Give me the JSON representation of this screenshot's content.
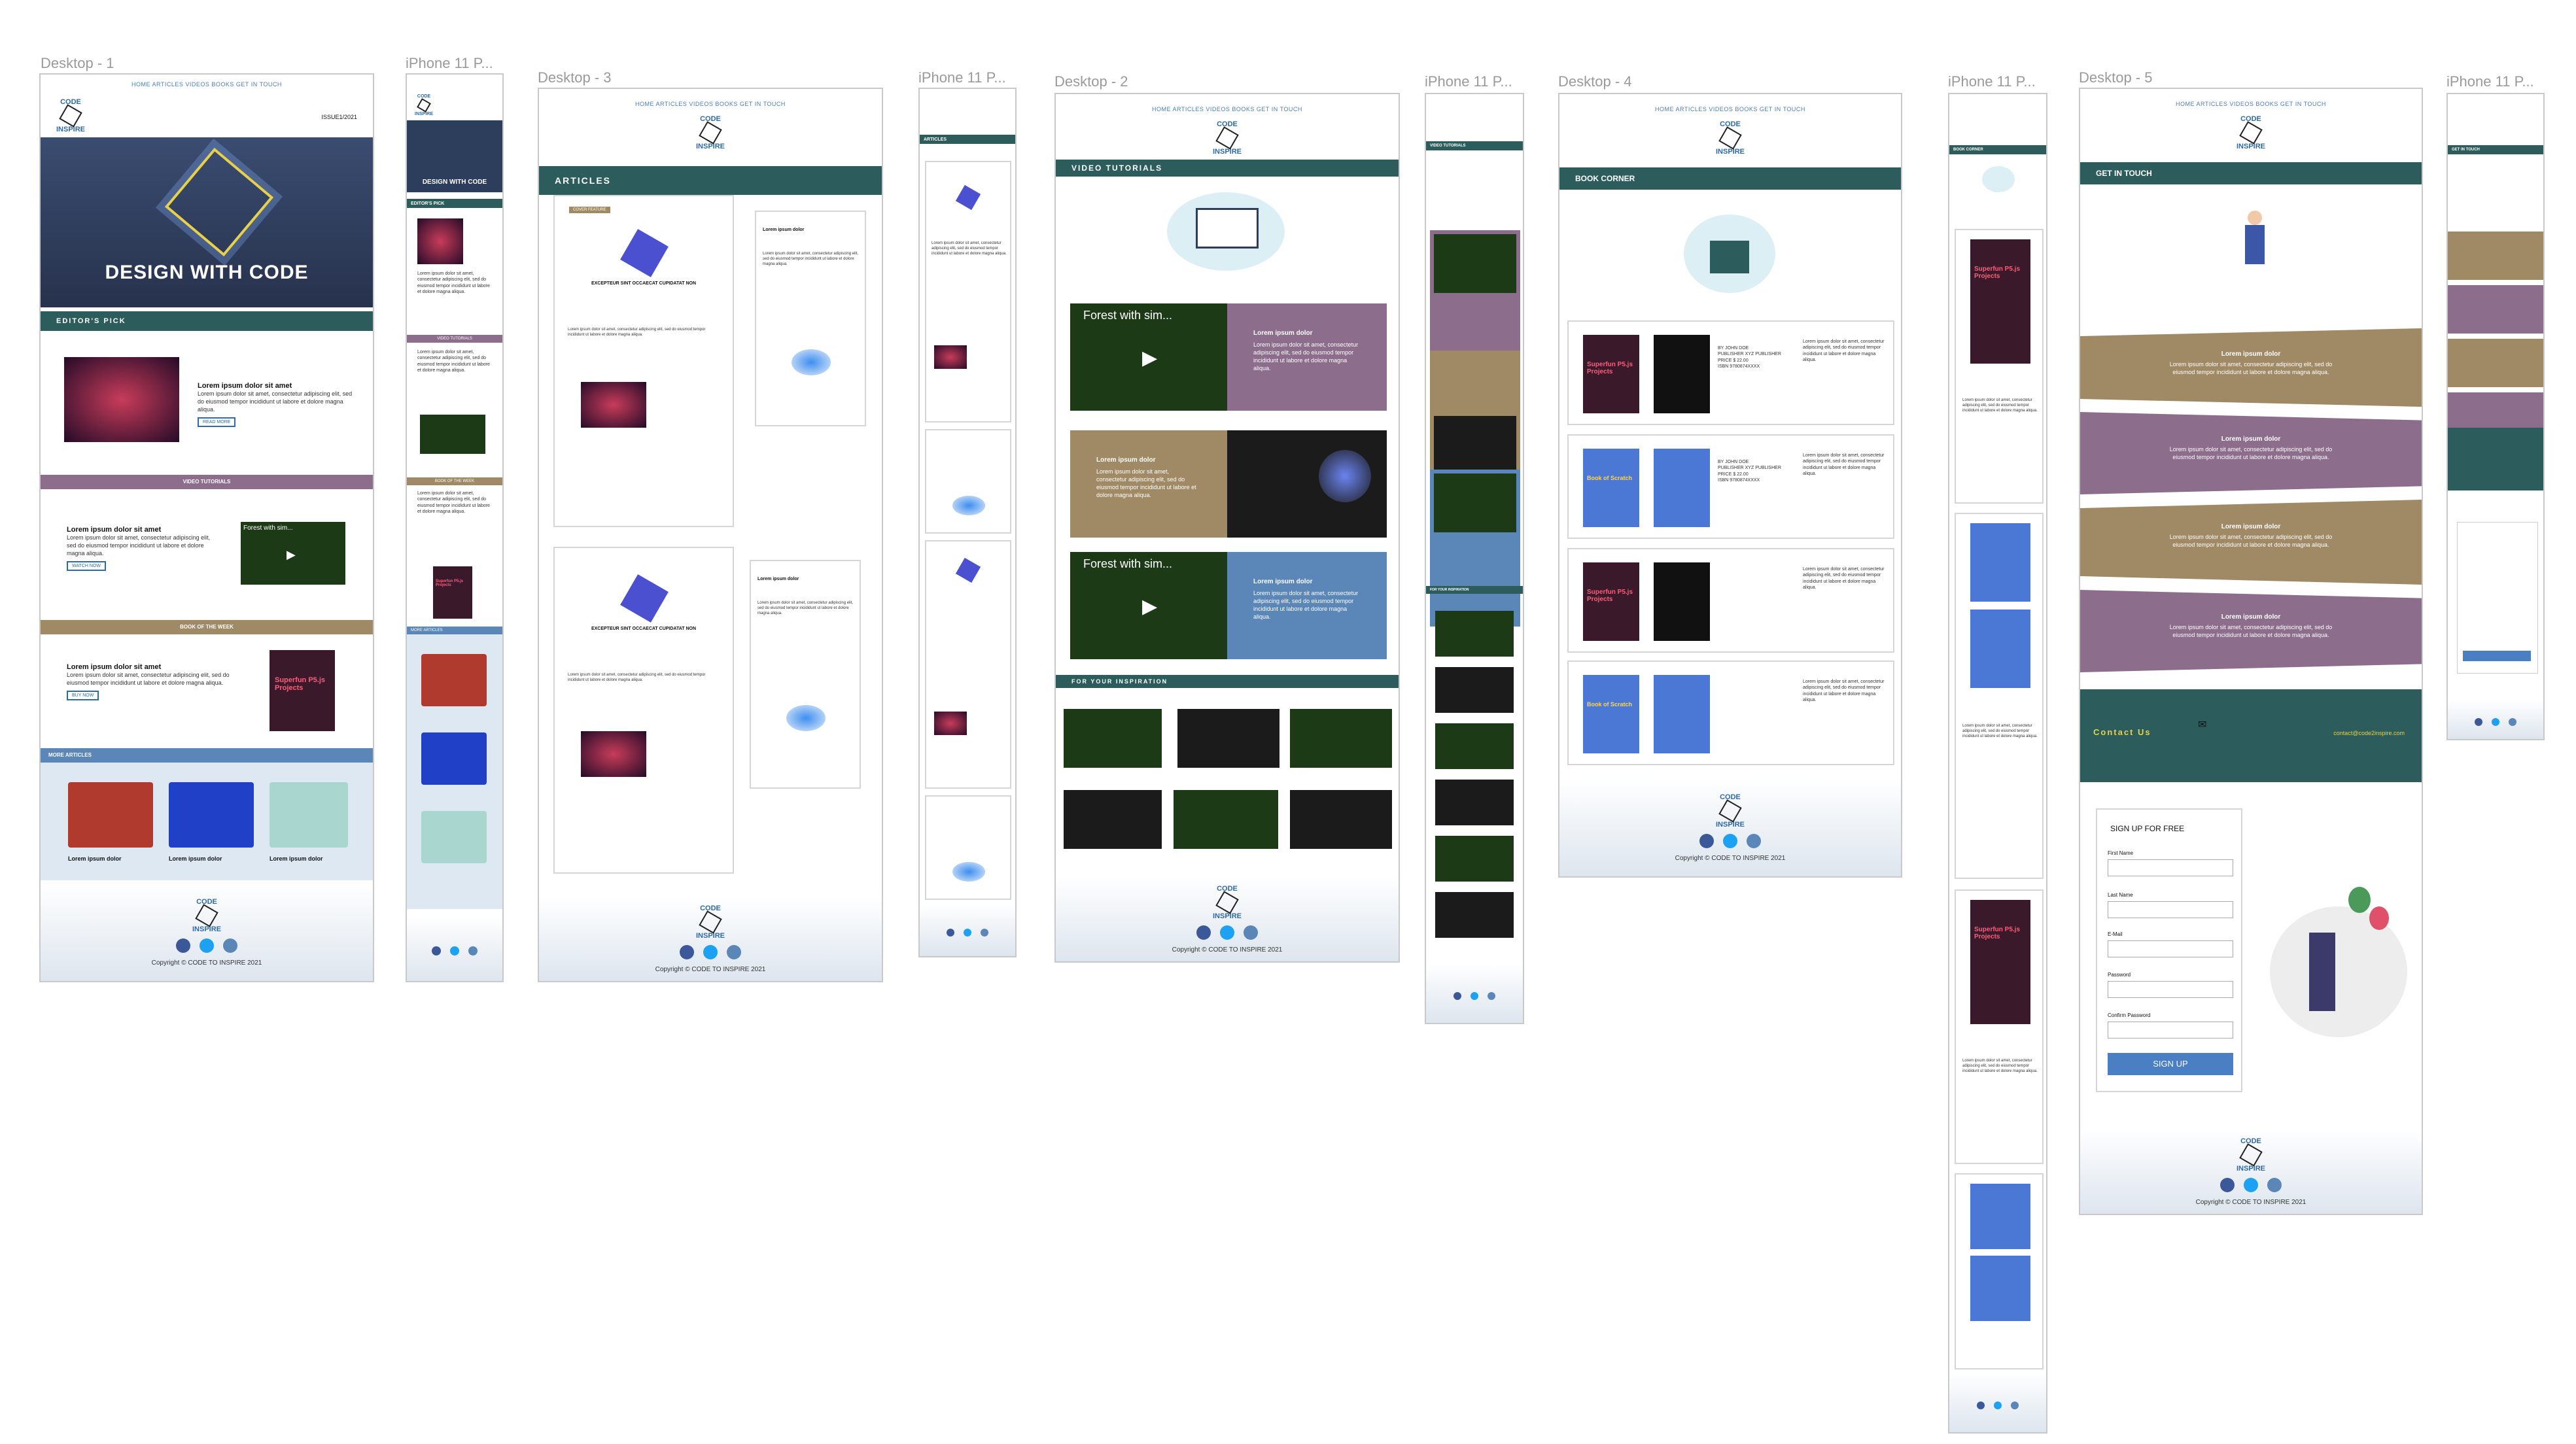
{
  "frames": {
    "desktop1": "Desktop - 1",
    "iphone1": "iPhone 11 P...",
    "desktop3": "Desktop - 3",
    "iphone3": "iPhone 11 P...",
    "desktop2": "Desktop - 2",
    "iphone2": "iPhone 11 P...",
    "desktop4": "Desktop - 4",
    "iphone4": "iPhone 11 P...",
    "desktop5": "Desktop - 5",
    "iphone5": "iPhone 11 P..."
  },
  "nav": "HOME  ARTICLES  VIDEOS  BOOKS  GET IN TOUCH",
  "logo": {
    "top": "CODE",
    "bottom": "INSPIRE"
  },
  "issue": "ISSUE1/2021",
  "hero_title": "DESIGN WITH CODE",
  "sections": {
    "editors_pick": "EDITOR'S PICK",
    "video_tutorials": "VIDEO TUTORIALS",
    "book_of_week": "BOOK OF THE WEEK",
    "more_articles": "MORE ARTICLES",
    "articles": "ARTICLES",
    "for_inspiration": "FOR YOUR INSPIRATION",
    "book_corner": "BOOK CORNER",
    "get_in_touch": "GET IN TOUCH"
  },
  "lorem_title": "Lorem ipsum dolor sit amet",
  "lorem_short": "Lorem ipsum dolor",
  "lorem_body": "Lorem ipsum dolor sit amet, consectetur adipiscing elit, sed do eiusmod tempor incididunt ut labore et dolore magna aliqua.",
  "read_more": "READ MORE",
  "watch_now": "WATCH NOW",
  "buy_now": "BUY NOW",
  "video_title": "Forest with sim...",
  "article_heading": "EXCEPTEUR SINT OCCAECAT CUPIDATAT NON",
  "cover_feature": "COVER FEATURE",
  "book_titles": {
    "a": "Superfun P5.js Projects",
    "b": "Book of Scratch"
  },
  "book_meta": {
    "by": "BY",
    "author": "JOHN DOE",
    "publisher_label": "PUBLISHER",
    "publisher": "XYZ PUBLISHER",
    "price_label": "PRICE",
    "price": "$ 22.00",
    "isbn_label": "ISBN",
    "isbn": "9780874XXXX"
  },
  "contact_us": "Contact Us",
  "email": "contact@code2inspire.com",
  "signup": {
    "title": "SIGN UP FOR FREE",
    "first": "First Name",
    "last": "Last Name",
    "email": "E-Mail",
    "password": "Password",
    "confirm": "Confirm Password",
    "button": "SIGN UP"
  },
  "copyright": "Copyright © CODE TO INSPIRE 2021",
  "colors": {
    "teal": "#2c5d5c",
    "mauve": "#8c6d8c",
    "tan": "#a08a66",
    "steel": "#5b86b8",
    "navy": "#2d3e5c"
  }
}
